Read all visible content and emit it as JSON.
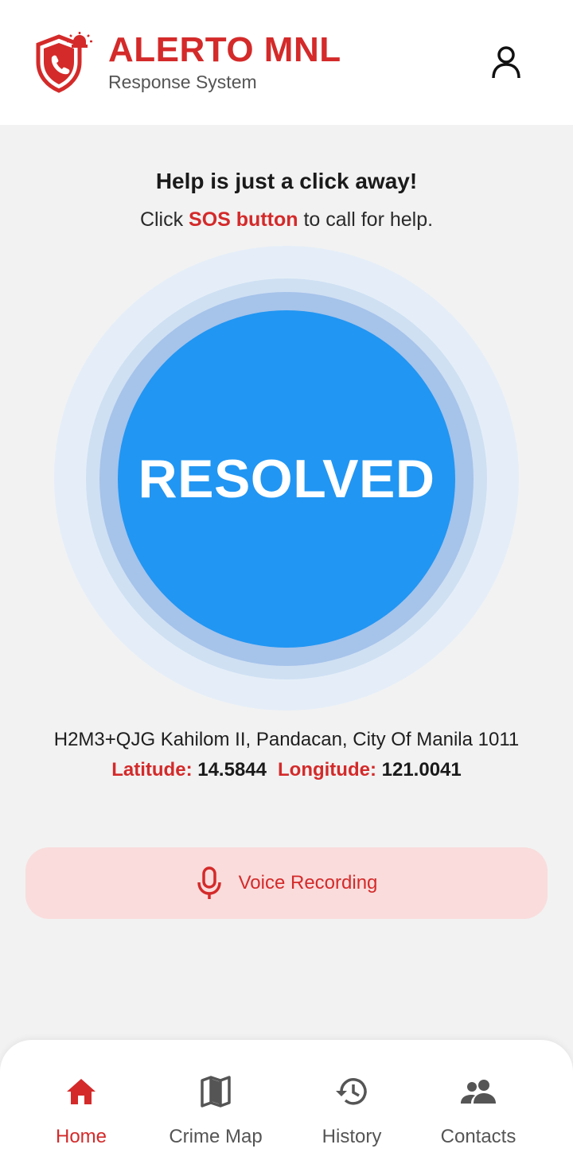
{
  "header": {
    "title": "ALERTO MNL",
    "subtitle": "Response System",
    "logo_icon": "shield-phone-alarm-icon",
    "profile_icon": "user-icon"
  },
  "help": {
    "title": "Help is just a click away!",
    "sub_prefix": "Click ",
    "sub_highlight": "SOS button",
    "sub_suffix": " to call for help."
  },
  "sos": {
    "label": "RESOLVED",
    "color": "#2196f3"
  },
  "location": {
    "address": "H2M3+QJG Kahilom II, Pandacan, City Of Manila 1011",
    "latitude_label": "Latitude:",
    "latitude": "14.5844",
    "longitude_label": "Longitude:",
    "longitude": "121.0041"
  },
  "voice": {
    "label": "Voice Recording",
    "icon": "microphone-icon"
  },
  "nav": {
    "items": [
      {
        "label": "Home",
        "icon": "home-icon",
        "active": true
      },
      {
        "label": "Crime Map",
        "icon": "map-icon",
        "active": false
      },
      {
        "label": "History",
        "icon": "history-icon",
        "active": false
      },
      {
        "label": "Contacts",
        "icon": "people-icon",
        "active": false
      }
    ]
  },
  "colors": {
    "accent_red": "#d42a2a",
    "sos_blue": "#2196f3",
    "voice_bg": "#fadcdc"
  }
}
